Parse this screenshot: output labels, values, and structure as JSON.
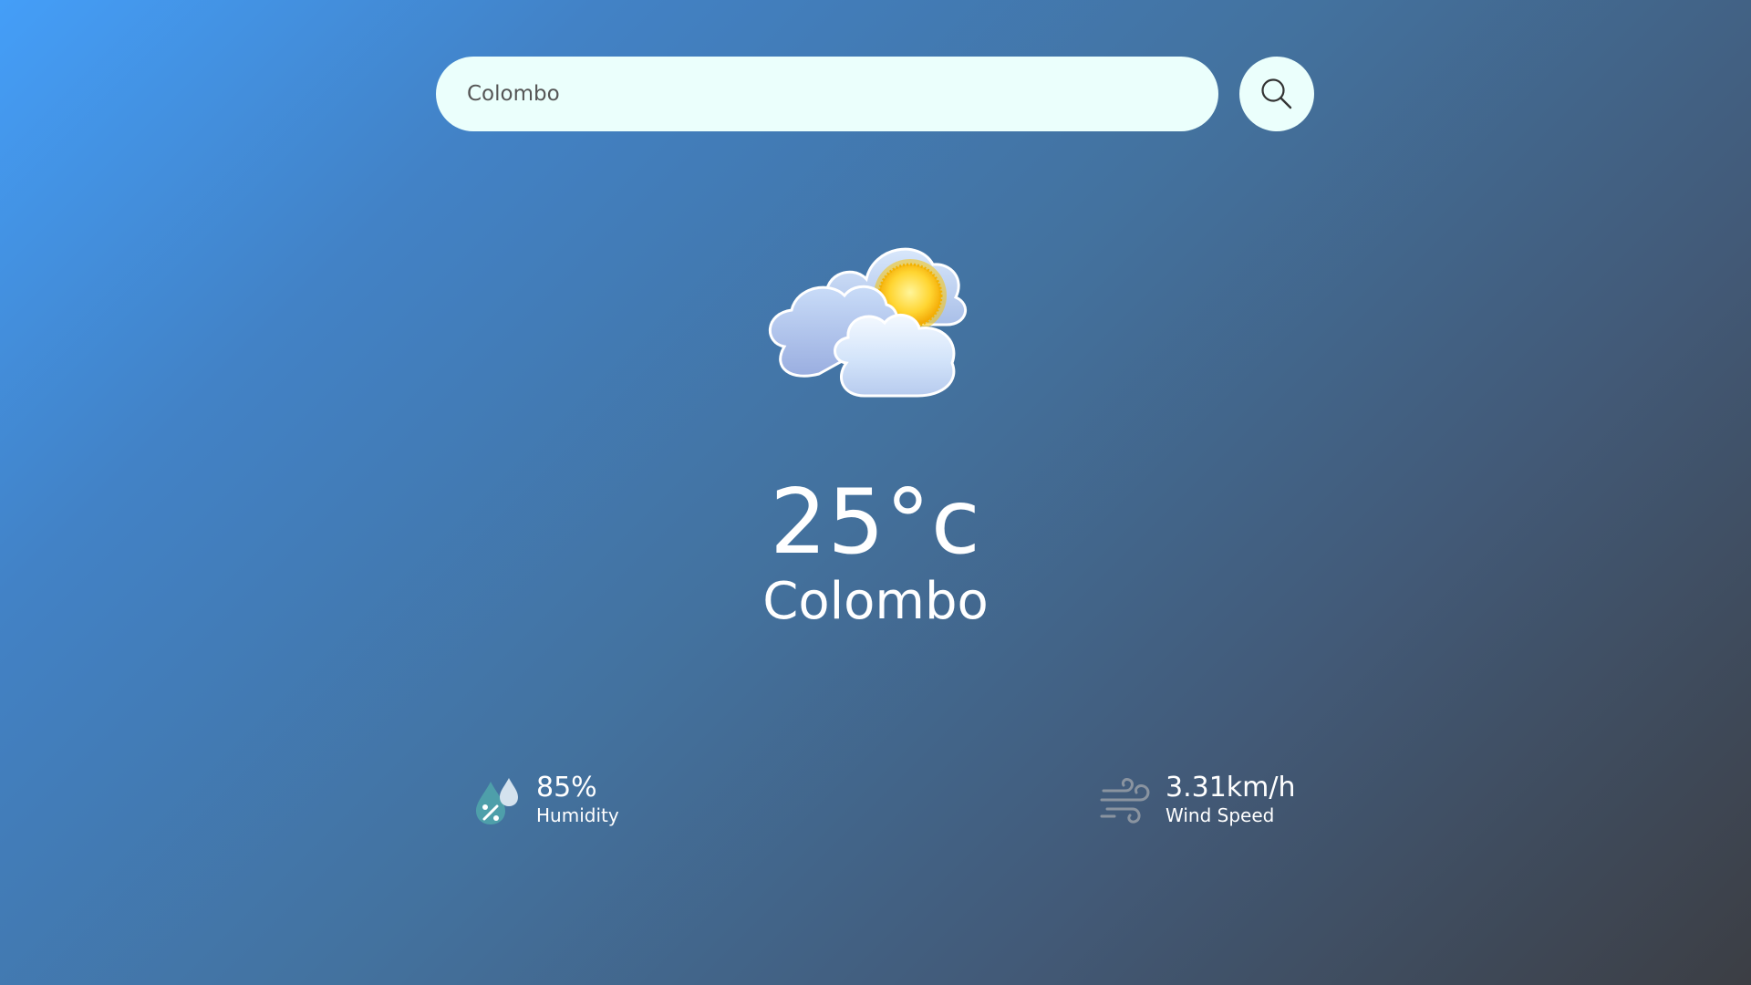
{
  "search": {
    "value": "Colombo",
    "button_icon": "search-icon"
  },
  "weather": {
    "icon": "partly-cloudy-icon",
    "temperature": "25°c",
    "city": "Colombo"
  },
  "details": {
    "humidity": {
      "icon": "humidity-icon",
      "value": "85%",
      "label": "Humidity"
    },
    "wind": {
      "icon": "wind-icon",
      "value": "3.31km/h",
      "label": "Wind Speed"
    }
  },
  "colors": {
    "background_start": "#449ef8",
    "background_end": "#3c3e44",
    "search_background": "#ebfffc",
    "text": "#ffffff"
  }
}
